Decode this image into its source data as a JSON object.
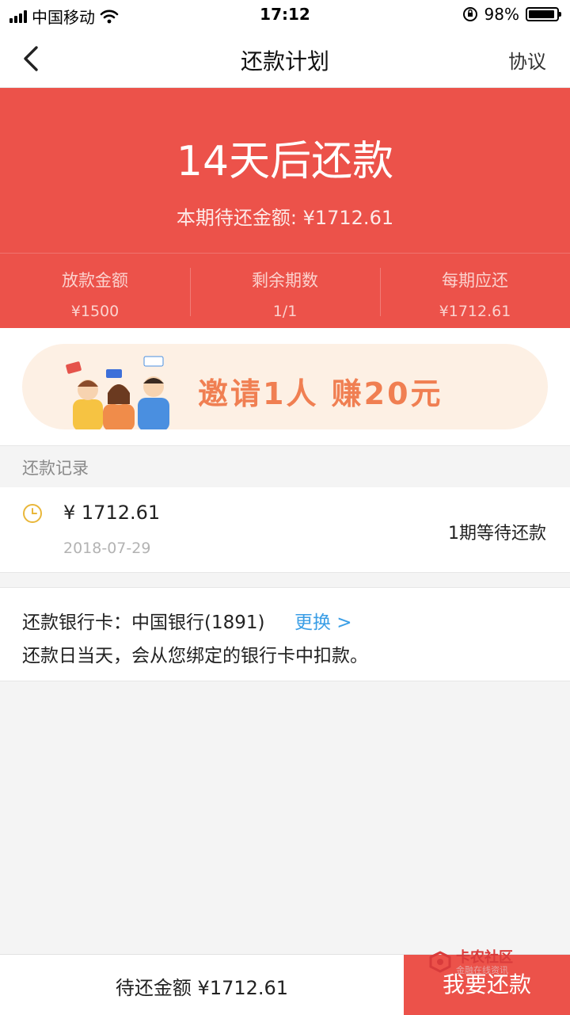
{
  "status_bar": {
    "carrier": "中国移动",
    "time": "17:12",
    "battery": "98%"
  },
  "nav": {
    "title": "还款计划",
    "right_action": "协议"
  },
  "hero": {
    "main": "14天后还款",
    "sub": "本期待还金额: ¥1712.61",
    "stats": [
      {
        "label": "放款金额",
        "value": "¥1500"
      },
      {
        "label": "剩余期数",
        "value": "1/1"
      },
      {
        "label": "每期应还",
        "value": "¥1712.61"
      }
    ]
  },
  "banner": {
    "text": "邀请1人 赚20元"
  },
  "records": {
    "header": "还款记录",
    "items": [
      {
        "amount": "¥ 1712.61",
        "date": "2018-07-29",
        "status": "1期等待还款"
      }
    ]
  },
  "bank": {
    "line1": "还款银行卡：中国银行(1891)",
    "change": "更换 >",
    "line2": "还款日当天，会从您绑定的银行卡中扣款。"
  },
  "bottom": {
    "amount_text": "待还金额 ¥1712.61",
    "pay_button": "我要还款"
  },
  "watermark": {
    "title": "卡农社区",
    "subtitle": "金融在线资讯"
  },
  "colors": {
    "primary_red": "#ec524a",
    "link_blue": "#3a9ee6",
    "clock_yellow": "#e9b73a"
  }
}
